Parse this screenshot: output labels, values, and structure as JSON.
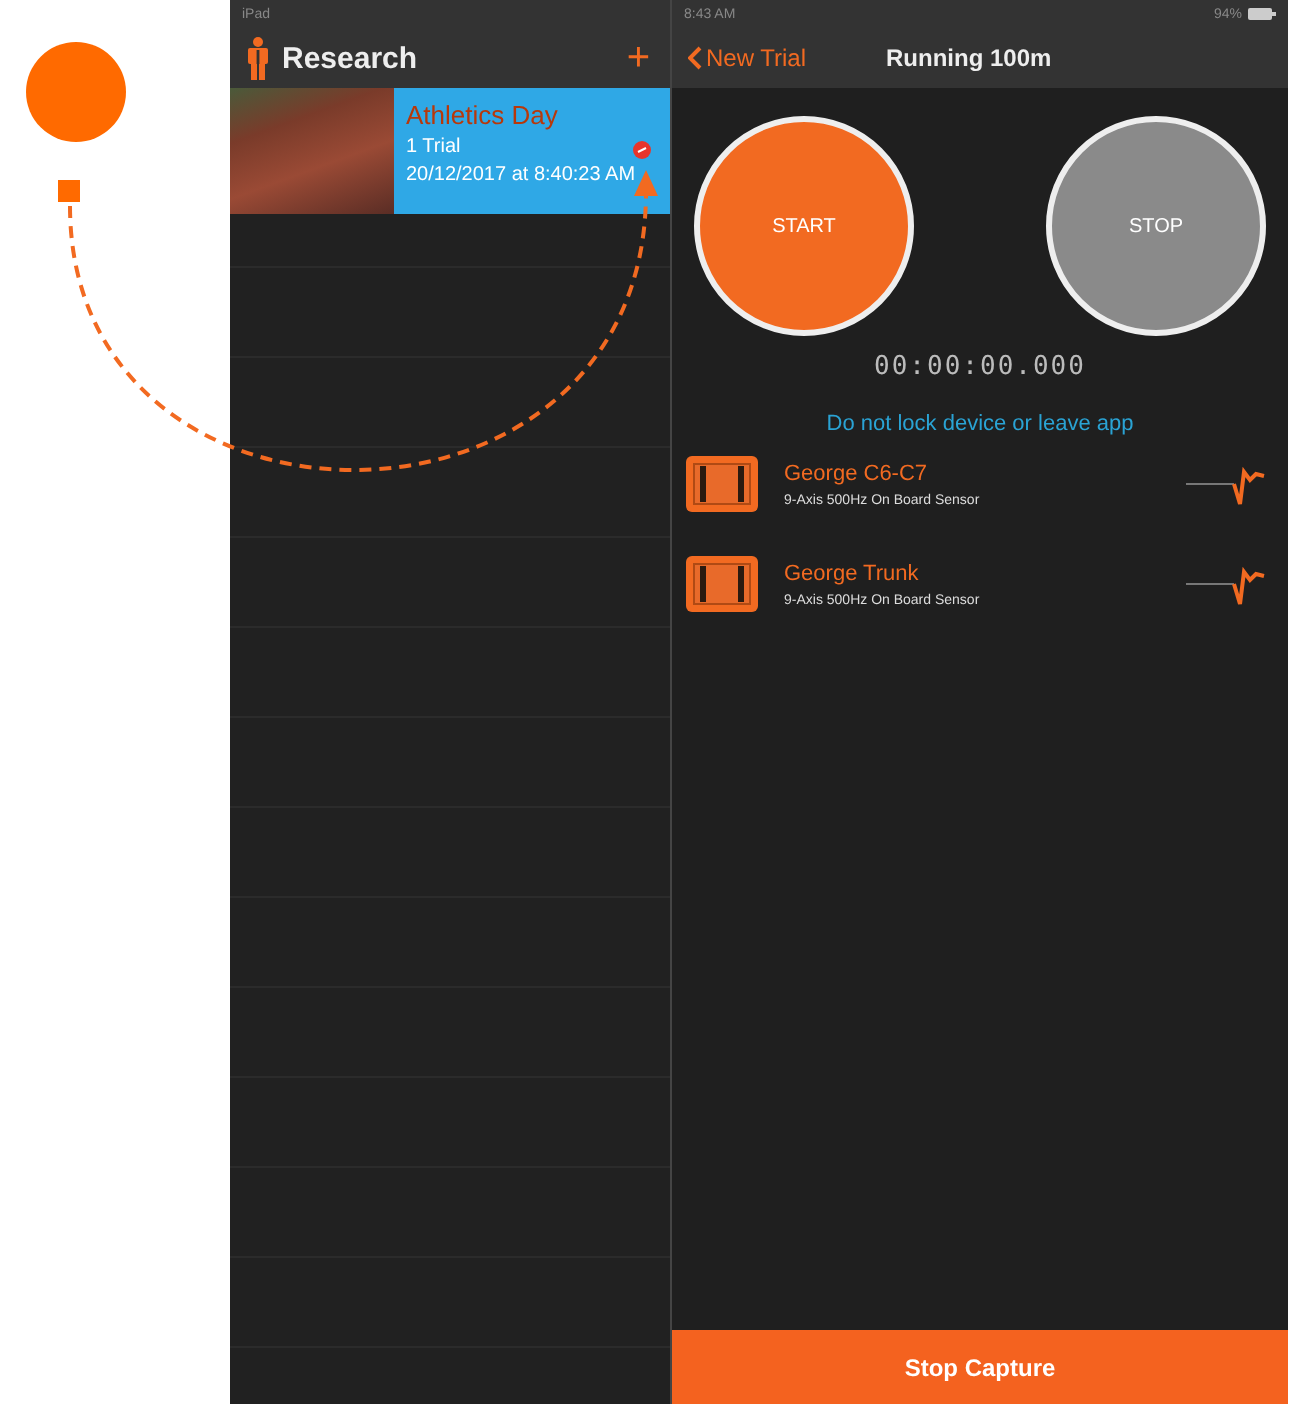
{
  "sidebar": {
    "status_bar": {
      "carrier": "iPad"
    },
    "title": "Research",
    "add_button": "+",
    "trials": [
      {
        "title": "Athletics Day",
        "count": "1 Trial",
        "date": "20/12/2017 at 8:40:23 AM",
        "selected": true
      }
    ]
  },
  "detail": {
    "status_bar": {
      "time": "8:43 AM",
      "battery": "94%"
    },
    "back_button": "New Trial",
    "title": "Running 100m",
    "start_button": "START",
    "stop_button": "STOP",
    "timer": "00:00:00.000",
    "warning": "Do not lock device or leave app",
    "sensors": [
      {
        "name": "George C6-C7",
        "description": "9-Axis 500Hz On Board Sensor"
      },
      {
        "name": "George Trunk",
        "description": "9-Axis 500Hz On Board Sensor"
      }
    ],
    "footer_button": "Stop Capture"
  }
}
